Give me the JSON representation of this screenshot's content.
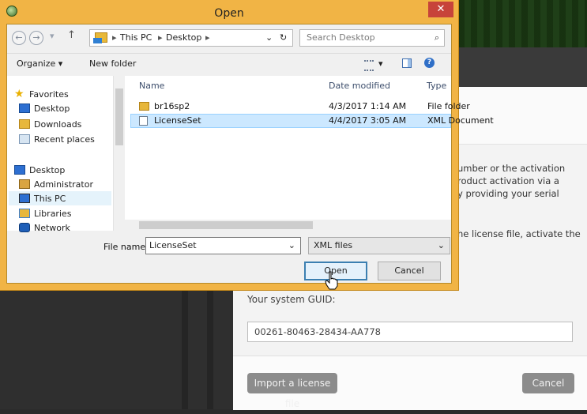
{
  "background": {
    "panel_text_lines": [
      "umber or the activation",
      "roduct activation via a",
      "y providing your serial",
      "he license file, activate the"
    ],
    "guid_label": "Your system GUID:",
    "guid_value": "00261-80463-28434-AA778",
    "import_button": "Import a license file",
    "cancel_button": "Cancel"
  },
  "dialog": {
    "title": "Open",
    "close_glyph": "✕",
    "nav": {
      "back": "←",
      "forward": "→",
      "recent": "▾",
      "up": "↑"
    },
    "breadcrumb": [
      "This PC",
      "Desktop"
    ],
    "breadcrumb_sep": "▸",
    "address_dropdown": "⌄",
    "refresh_glyph": "↻",
    "search_placeholder": "Search Desktop",
    "search_glyph": "⌕",
    "toolbar": {
      "organize": "Organize ▾",
      "new_folder": "New folder",
      "view_menu": "▾",
      "help": "?"
    },
    "nav_pane": [
      {
        "label": "Favorites",
        "icon": "star-icon"
      },
      {
        "label": "Desktop",
        "icon": "desktop-icon"
      },
      {
        "label": "Downloads",
        "icon": "downloads-icon"
      },
      {
        "label": "Recent places",
        "icon": "recent-places-icon"
      },
      {
        "label": "Desktop",
        "icon": "desktop-icon"
      },
      {
        "label": "Administrator",
        "icon": "user-icon"
      },
      {
        "label": "This PC",
        "icon": "computer-icon"
      },
      {
        "label": "Libraries",
        "icon": "libraries-icon"
      },
      {
        "label": "Network",
        "icon": "network-icon"
      }
    ],
    "columns": {
      "name": "Name",
      "date_modified": "Date modified",
      "type": "Type"
    },
    "files": [
      {
        "name": "br16sp2",
        "date": "4/3/2017 1:14 AM",
        "type": "File folder",
        "icon": "folder-icon",
        "selected": false
      },
      {
        "name": "LicenseSet",
        "date": "4/4/2017 3:05 AM",
        "type": "XML Document",
        "icon": "xml-file-icon",
        "selected": true
      }
    ],
    "file_name_label": "File name:",
    "file_name_value": "LicenseSet",
    "file_type_value": "XML files",
    "open_button": "Open",
    "cancel_button": "Cancel"
  }
}
